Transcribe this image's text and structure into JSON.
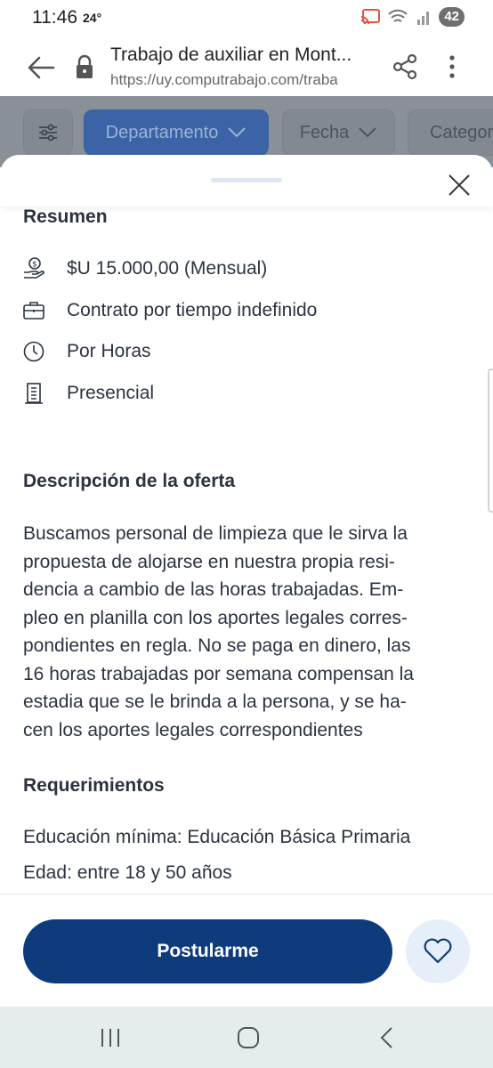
{
  "status_bar": {
    "time": "11:46",
    "temperature": "24°",
    "battery": "42",
    "icons": [
      "cast-icon",
      "wifi-icon",
      "signal-icon",
      "battery-icon"
    ]
  },
  "browser": {
    "title": "Trabajo de auxiliar en Mont...",
    "url": "https://uy.computrabajo.com/traba",
    "icons": [
      "back-arrow-icon",
      "lock-icon",
      "share-icon",
      "more-vert-icon"
    ]
  },
  "filters": {
    "items": [
      {
        "label": "Departamento",
        "active": true
      },
      {
        "label": "Fecha",
        "active": false
      },
      {
        "label": "Categor",
        "active": false
      }
    ],
    "active_color": "#3b63a6"
  },
  "sheet": {
    "summary": {
      "title": "Resumen",
      "items": [
        {
          "icon": "salary-hand-icon",
          "text": "$U 15.000,00 (Mensual)"
        },
        {
          "icon": "briefcase-icon",
          "text": "Contrato por tiempo indefinido"
        },
        {
          "icon": "clock-icon",
          "text": "Por Horas"
        },
        {
          "icon": "building-icon",
          "text": "Presencial"
        }
      ]
    },
    "description": {
      "title": "Descripción de la oferta",
      "lines": [
        "Buscamos personal de limpieza que le sirva la",
        "propuesta de alojarse en nuestra propia resi-",
        "dencia a cambio de las horas trabajadas. Em-",
        "pleo en planilla con los aportes legales corres-",
        "pondientes en regla. No se paga en dinero, las",
        "16 horas trabajadas por semana compensan la",
        "estadia que se le brinda a la persona, y se ha-",
        "cen los aportes legales correspondientes"
      ]
    },
    "requirements": {
      "title": "Requerimientos",
      "education": "Educación mínima: Educación Básica Primaria",
      "age": "Edad: entre 18 y 50 años"
    }
  },
  "actions": {
    "apply_label": "Postularme",
    "apply_color": "#0e3b7c",
    "favorite_icon": "heart-icon"
  },
  "nav_bar": {
    "icons": [
      "recent-apps-icon",
      "home-icon",
      "back-icon"
    ]
  }
}
